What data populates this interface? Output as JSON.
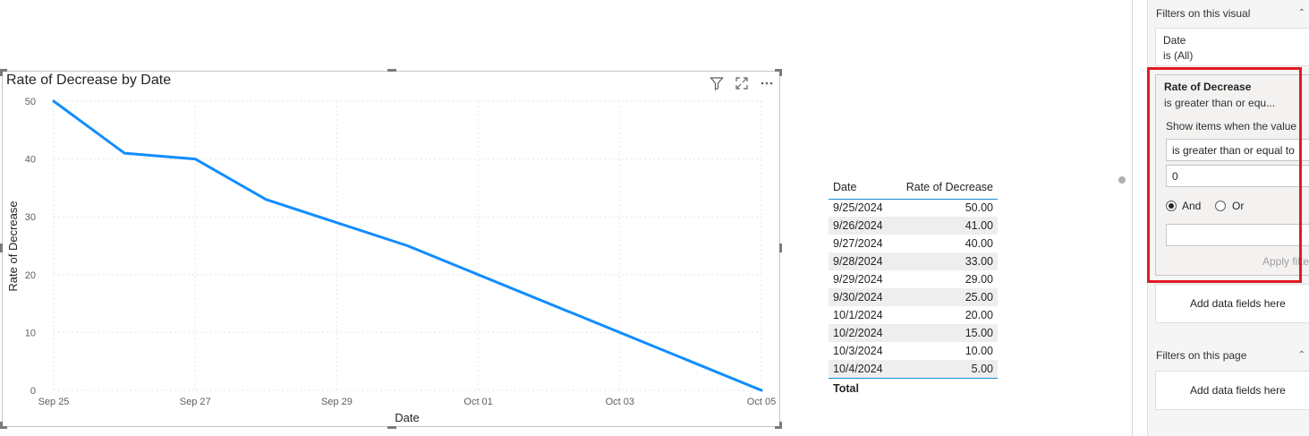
{
  "colors": {
    "series": "#118DFF",
    "highlight": "#E01B24",
    "grid": "#E6E6E6",
    "table_accent": "#1A8AD4"
  },
  "visual": {
    "title": "Rate of Decrease by Date",
    "icons": [
      "filter-icon",
      "focus-mode-icon",
      "more-options-icon"
    ]
  },
  "chart_data": {
    "type": "line",
    "title": "Rate of Decrease by Date",
    "xlabel": "Date",
    "ylabel": "Rate of Decrease",
    "x": [
      "2024-09-25",
      "2024-09-26",
      "2024-09-27",
      "2024-09-28",
      "2024-09-29",
      "2024-09-30",
      "2024-10-01",
      "2024-10-02",
      "2024-10-03",
      "2024-10-04",
      "2024-10-05"
    ],
    "x_ticks": [
      "Sep 25",
      "Sep 27",
      "Sep 29",
      "Oct 01",
      "Oct 03",
      "Oct 05"
    ],
    "series": [
      {
        "values": [
          50,
          41,
          40,
          33,
          29,
          25,
          20,
          15,
          10,
          5,
          0
        ]
      }
    ],
    "ylim": [
      0,
      50
    ],
    "y_ticks": [
      0,
      10,
      20,
      30,
      40,
      50
    ],
    "grid": true,
    "legend": "none"
  },
  "table": {
    "headers": [
      "Date",
      "Rate of Decrease"
    ],
    "rows": [
      [
        "9/25/2024",
        "50.00"
      ],
      [
        "9/26/2024",
        "41.00"
      ],
      [
        "9/27/2024",
        "40.00"
      ],
      [
        "9/28/2024",
        "33.00"
      ],
      [
        "9/29/2024",
        "29.00"
      ],
      [
        "9/30/2024",
        "25.00"
      ],
      [
        "10/1/2024",
        "20.00"
      ],
      [
        "10/2/2024",
        "15.00"
      ],
      [
        "10/3/2024",
        "10.00"
      ],
      [
        "10/4/2024",
        "5.00"
      ]
    ],
    "total_label": "Total"
  },
  "filter_pane": {
    "visual_heading": "Filters on this visual",
    "date_filter": {
      "name": "Date",
      "state": "is (All)"
    },
    "rate_filter": {
      "name": "Rate of Decrease",
      "summary": "is greater than or equ...",
      "show_items_label": "Show items when the value",
      "operator": "is greater than or equal to",
      "value": "0",
      "and_label": "And",
      "or_label": "Or",
      "second_value": "",
      "apply_label": "Apply filter"
    },
    "add_fields_label": "Add data fields here",
    "page_heading": "Filters on this page",
    "page_add_fields_label": "Add data fields here"
  }
}
